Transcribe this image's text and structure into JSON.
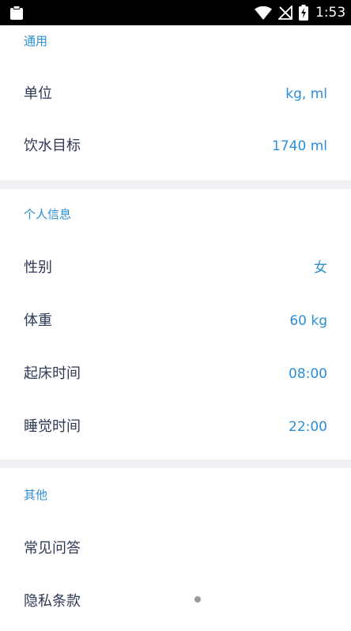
{
  "status_bar": {
    "time": "1:53",
    "icons": [
      "clipboard-icon",
      "wifi-icon",
      "no-signal-icon",
      "battery-charging-icon"
    ]
  },
  "sections": {
    "general": {
      "title": "通用",
      "rows": [
        {
          "label": "单位",
          "value": "kg, ml"
        },
        {
          "label": "饮水目标",
          "value": "1740 ml"
        }
      ]
    },
    "personal": {
      "title": "个人信息",
      "rows": [
        {
          "label": "性别",
          "value": "女"
        },
        {
          "label": "体重",
          "value": "60 kg"
        },
        {
          "label": "起床时间",
          "value": "08:00"
        },
        {
          "label": "睡觉时间",
          "value": "22:00"
        }
      ]
    },
    "other": {
      "title": "其他",
      "rows": [
        {
          "label": "常见问答"
        },
        {
          "label": "隐私条款"
        }
      ]
    }
  },
  "colors": {
    "accent": "#2b8fd6",
    "label": "#2c3a55",
    "divider": "#f0f1f4",
    "status_bar": "#000000"
  }
}
